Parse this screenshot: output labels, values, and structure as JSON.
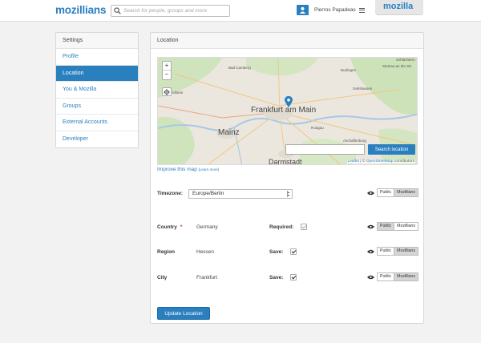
{
  "header": {
    "logo": "mozillians",
    "search_placeholder": "Search for people, groups and more",
    "user_name": "Pierros Papadeas",
    "tab_label": "mozilla"
  },
  "sidebar": {
    "title": "Settings",
    "items": [
      {
        "label": "Profile",
        "active": false
      },
      {
        "label": "Location",
        "active": true
      },
      {
        "label": "You & Mozilla",
        "active": false
      },
      {
        "label": "Groups",
        "active": false
      },
      {
        "label": "External Accounts",
        "active": false
      },
      {
        "label": "Developer",
        "active": false
      }
    ]
  },
  "panel": {
    "title": "Location",
    "map": {
      "zoom_in": "+",
      "zoom_out": "−",
      "city_main": "Frankfurt am Main",
      "city_mainz": "Mainz",
      "city_darmstadt": "Darmstadt",
      "small_labels": [
        "Bad Camberg",
        "Budingen",
        "Gelnhausen",
        "Rodgau",
        "Aschaffenburg",
        "Steinau an der Str",
        "Schlüchtern",
        "Idstein"
      ],
      "search_value": "",
      "search_button": "Search location",
      "attribution_leaflet": "Leaflet",
      "attribution_sep": " | © ",
      "attribution_osm": "OpenStreetMap",
      "attribution_tail": " contributors"
    },
    "improve_link": "Improve this map",
    "learn_more": "[Learn more]",
    "timezone": {
      "label": "Timezone:",
      "value": "Europe/Berlin"
    },
    "country": {
      "label": "Country",
      "required_mark": "*",
      "value": "Germany",
      "flag_label": "Required:",
      "checked": true
    },
    "region": {
      "label": "Region",
      "value": "Hessen",
      "flag_label": "Save:",
      "checked": true
    },
    "city": {
      "label": "City",
      "value": "Frankfurt",
      "flag_label": "Save:",
      "checked": true
    },
    "privacy": {
      "public": "Public",
      "mozillians": "Mozillians"
    },
    "update_button": "Update Location"
  },
  "colors": {
    "brand": "#2a7fbf",
    "active_nav": "#2a7fbf",
    "required": "#c0392b"
  }
}
